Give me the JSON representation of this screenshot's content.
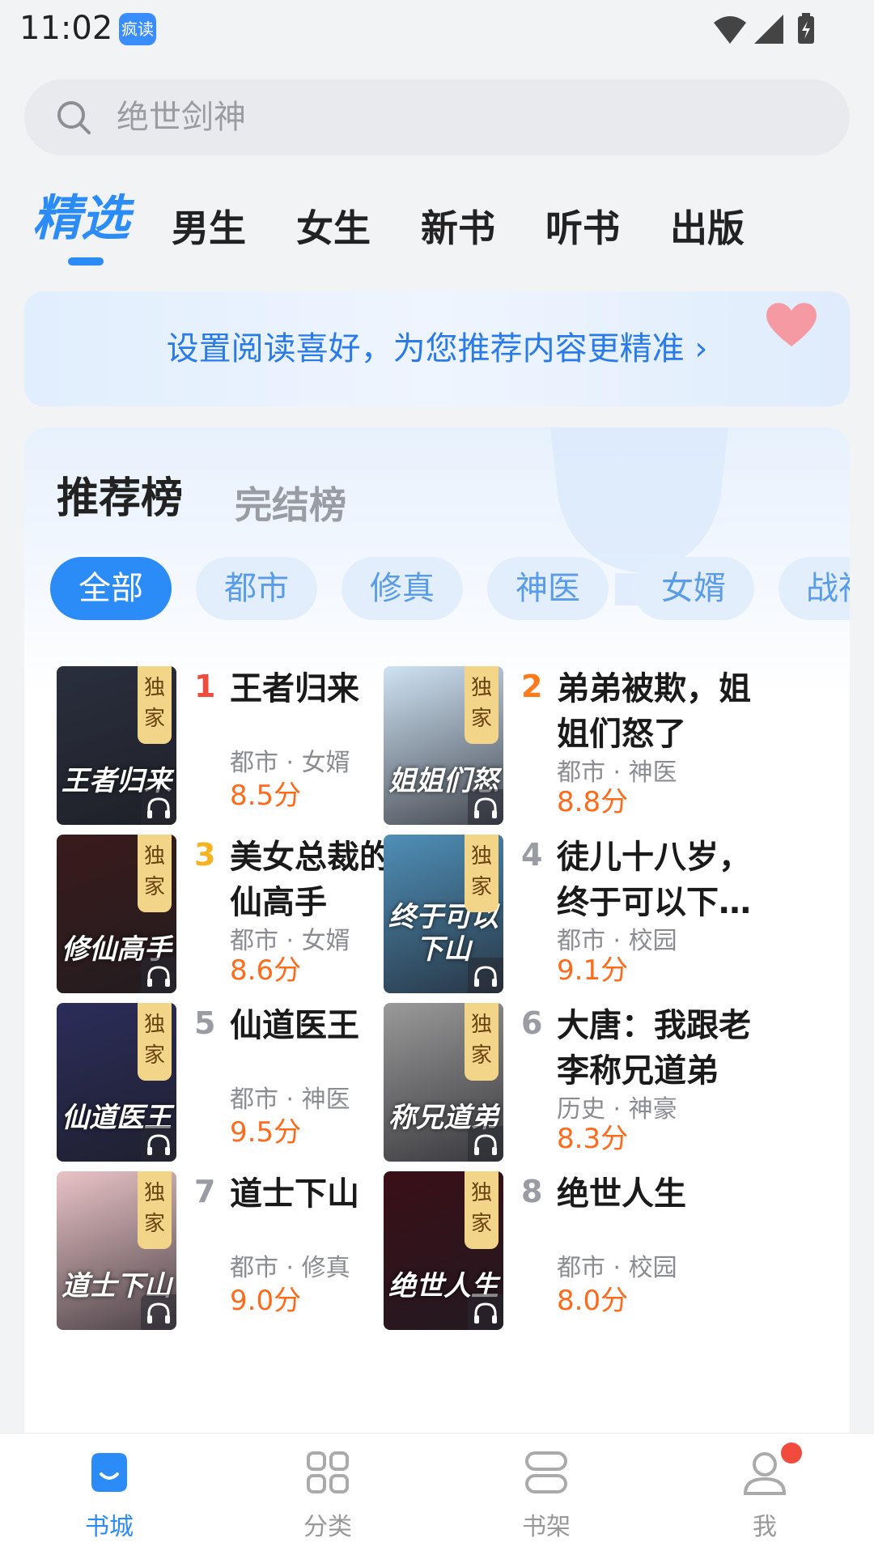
{
  "status": {
    "time": "11:02",
    "app_badge": "疯读"
  },
  "search": {
    "placeholder": "绝世剑神"
  },
  "tabs": [
    "精选",
    "男生",
    "女生",
    "新书",
    "听书",
    "出版"
  ],
  "banner": {
    "text": "设置阅读喜好，为您推荐内容更精准 ›"
  },
  "ranking": {
    "tabs": [
      "推荐榜",
      "完结榜"
    ],
    "chips": [
      "全部",
      "都市",
      "修真",
      "神医",
      "女婿",
      "战神"
    ],
    "exclusive_label": [
      "独",
      "家"
    ],
    "books": [
      {
        "rank": "1",
        "title": "王者归来",
        "meta": "都市 · 女婿",
        "score": "8.5分",
        "cover_text": "王者归来",
        "cover_color": "#2a2f3e",
        "rank_color": "#f04b3c"
      },
      {
        "rank": "2",
        "title": "弟弟被欺，姐姐们怒了",
        "meta": "都市 · 神医",
        "score": "8.8分",
        "cover_text": "姐姐们怒",
        "cover_color": "#cfe3f4",
        "rank_color": "#ff7a1a"
      },
      {
        "rank": "3",
        "title": "美女总裁的修仙高手",
        "meta": "都市 · 女婿",
        "score": "8.6分",
        "cover_text": "修仙高手",
        "cover_color": "#3a1b1b",
        "rank_color": "#f5b321"
      },
      {
        "rank": "4",
        "title": "徒儿十八岁，终于可以下…",
        "meta": "都市 · 校园",
        "score": "9.1分",
        "cover_text": "终于可以下山",
        "cover_color": "#4f8fb8",
        "rank_color": "#9a9ca3"
      },
      {
        "rank": "5",
        "title": "仙道医王",
        "meta": "都市 · 神医",
        "score": "9.5分",
        "cover_text": "仙道医王",
        "cover_color": "#2b2d5a",
        "rank_color": "#9a9ca3"
      },
      {
        "rank": "6",
        "title": "大唐：我跟老李称兄道弟",
        "meta": "历史 · 神豪",
        "score": "8.3分",
        "cover_text": "称兄道弟",
        "cover_color": "#9a9a9a",
        "rank_color": "#9a9ca3"
      },
      {
        "rank": "7",
        "title": "道士下山",
        "meta": "都市 · 修真",
        "score": "9.0分",
        "cover_text": "道士下山",
        "cover_color": "#e9c3c6",
        "rank_color": "#9a9ca3"
      },
      {
        "rank": "8",
        "title": "绝世人生",
        "meta": "都市 · 校园",
        "score": "8.0分",
        "cover_text": "绝世人生",
        "cover_color": "#3a0f18",
        "rank_color": "#9a9ca3"
      }
    ]
  },
  "bottom_nav": [
    "书城",
    "分类",
    "书架",
    "我"
  ],
  "colors": {
    "accent": "#2b8cf7",
    "score": "#ff6a1a"
  }
}
